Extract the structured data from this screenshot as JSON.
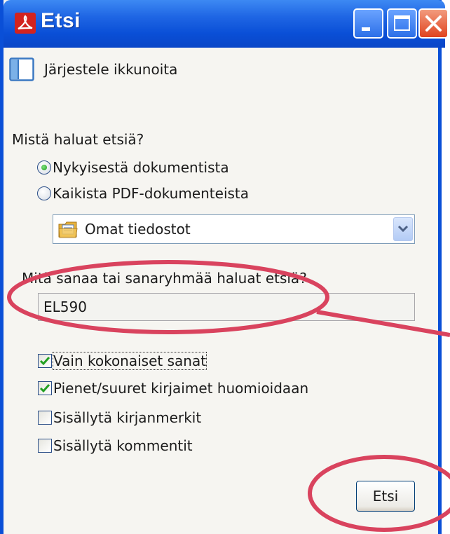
{
  "window": {
    "title": "Etsi",
    "title_icon": "adobe-pdf-icon"
  },
  "titlebar_buttons": [
    "minimize-icon",
    "maximize-icon",
    "close-icon"
  ],
  "arrange": {
    "label": "Järjestele ikkunoita",
    "icon": "window-layout-icon"
  },
  "where": {
    "question": "Mistä haluat etsiä?",
    "options": [
      {
        "label": "Nykyisestä dokumentista",
        "selected": true
      },
      {
        "label": "Kaikista PDF-dokumenteista",
        "selected": false
      }
    ],
    "location": {
      "value": "Omat tiedostot",
      "icon": "folder-documents-icon"
    }
  },
  "what": {
    "question": "Mitä sanaa tai sanaryhmää haluat etsiä?",
    "value": "EL590"
  },
  "options": [
    {
      "label": "Vain kokonaiset sanat",
      "checked": true
    },
    {
      "label": "Pienet/suuret kirjaimet huomioidaan",
      "checked": true
    },
    {
      "label": "Sisällytä kirjanmerkit",
      "checked": false
    },
    {
      "label": "Sisällytä kommentit",
      "checked": false
    }
  ],
  "search_button": {
    "label": "Etsi"
  },
  "colors": {
    "titlebar": "#0a4fd7",
    "annotation": "#d9435e",
    "check": "#22a022"
  }
}
